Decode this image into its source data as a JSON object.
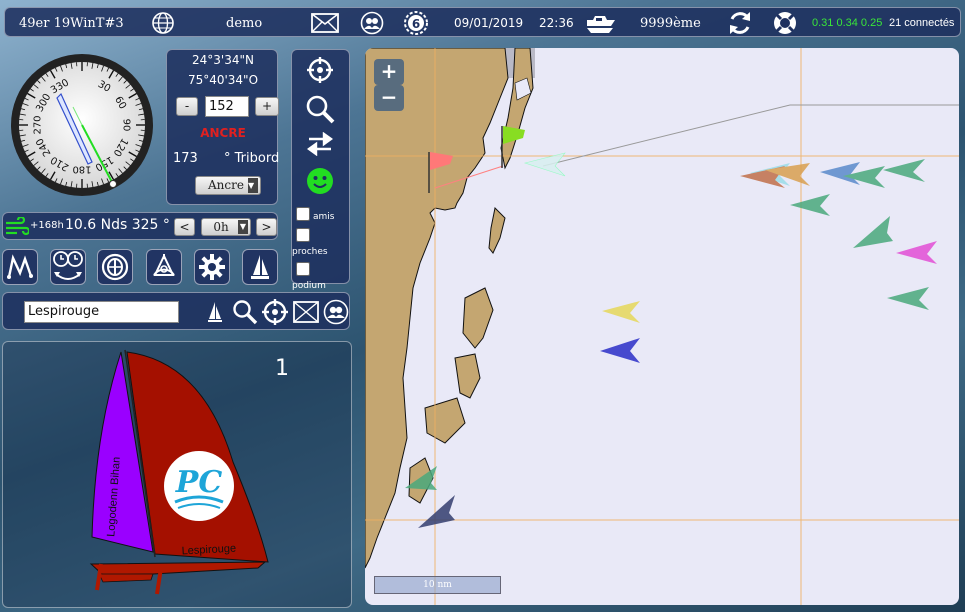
{
  "topbar": {
    "race_name": "49er 19WinT#3",
    "boat_name": "demo",
    "ranking_badge": "6",
    "date": "09/01/2019",
    "time": "22:36",
    "rank": "9999ème",
    "perf_values": "0.31 0.34 0.25",
    "connected": "21 connectés",
    "icons": [
      "globe-icon",
      "mail-icon",
      "friends-icon",
      "ranking-icon",
      "boat-type-icon",
      "refresh-icon",
      "help-lifebuoy-icon"
    ]
  },
  "compass": {
    "labels": [
      "30",
      "60",
      "90",
      "120",
      "150",
      "180",
      "210",
      "240",
      "270",
      "300",
      "330"
    ],
    "heading_deg": 152,
    "wind_from_deg": 325
  },
  "position": {
    "lat": "24°3'34\"N",
    "lon": "75°40'34\"O",
    "minus": "-",
    "plus": "+",
    "heading_value": "152",
    "status": "ANCRE",
    "status_color": "#e02020",
    "twa": "173",
    "tack": "° Tribord",
    "mode_select": "Ancre"
  },
  "wind": {
    "forecast": "+168h",
    "speed_dir": "10.6 Nds 325 °",
    "prev": "<",
    "next": ">",
    "offset_select": "0h"
  },
  "tools": {
    "icons": [
      "center-target-icon",
      "zoom-icon",
      "swap-arrows-icon",
      "smiley-icon"
    ],
    "filters": [
      {
        "label": "amis"
      },
      {
        "label": "proches"
      },
      {
        "label": "podium"
      }
    ]
  },
  "iconbar": [
    "route-icon",
    "timers-icon",
    "gps-icon",
    "sextant-icon",
    "settings-gear-icon",
    "sailboat-icon"
  ],
  "search": {
    "value": "Lespirouge",
    "icons": [
      "sailboat-small-icon",
      "search-icon",
      "target-icon",
      "mail-icon",
      "friends-icon"
    ]
  },
  "boat": {
    "number": "1",
    "sail_text_left": "Logodenn Bihan",
    "sail_text_right": "Lespirouge",
    "logo_text": "PC",
    "colors": {
      "jib": "#9a00ff",
      "main": "#a41000",
      "hull": "#b01800"
    }
  },
  "map": {
    "zoom_in": "+",
    "zoom_out": "−",
    "scale": "10 nm"
  }
}
